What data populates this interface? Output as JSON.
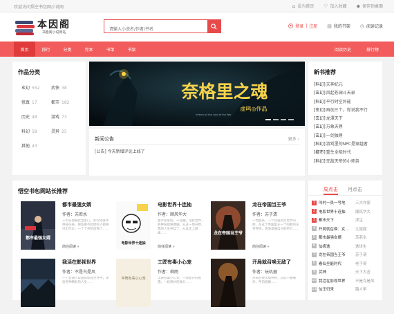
{
  "topbar": {
    "welcome": "欢迎访问悟空书包网小说网",
    "links": [
      "设为首页",
      "加入收藏",
      "保存到桌面"
    ]
  },
  "logo": {
    "title": "本因阁",
    "subtitle": "书趣阁小说网站"
  },
  "search": {
    "placeholder": "请输入小说名/作者/书名"
  },
  "header_links": {
    "login": "登录",
    "sep": "|",
    "register": "注册",
    "bookshelf": "我的书架",
    "history": "阅读记录"
  },
  "nav": {
    "items": [
      "首页",
      "排行",
      "分类",
      "完本",
      "书单",
      "书架"
    ],
    "right": [
      "阅读历史",
      "排行榜"
    ]
  },
  "categories": {
    "title": "作品分类",
    "items": [
      {
        "name": "玄幻",
        "count": "552"
      },
      {
        "name": "武侠",
        "count": "38"
      },
      {
        "name": "修真",
        "count": "17"
      },
      {
        "name": "都市",
        "count": "182"
      },
      {
        "name": "历史",
        "count": "48"
      },
      {
        "name": "游戏",
        "count": "73"
      },
      {
        "name": "科幻",
        "count": "58"
      },
      {
        "name": "灵异",
        "count": "25"
      },
      {
        "name": "其他",
        "count": "43"
      }
    ]
  },
  "banner": {
    "title": "奈格里之魂",
    "caption": "虚鸣◎作品",
    "english": "Inferno of the Lord of the War"
  },
  "news": {
    "title": "新闻公告",
    "more": "更多 ›",
    "item": "[公告] 今天新增评论上线了"
  },
  "recommend": {
    "title": "新书推荐",
    "items": [
      {
        "tag": "[科幻]",
        "name": "天神纪元"
      },
      {
        "tag": "[玄幻]",
        "name": "风起苍澜斗天录"
      },
      {
        "tag": "[科幻]",
        "name": "平行时空异能"
      },
      {
        "tag": "[玄幻]",
        "name": "再创三个，你说我不行"
      },
      {
        "tag": "[玄幻]",
        "name": "龙潭天下"
      },
      {
        "tag": "[玄幻]",
        "name": "万象天尊"
      },
      {
        "tag": "[玄幻]",
        "name": "一剑独尊"
      },
      {
        "tag": "[科幻]",
        "name": "游戏里的NPC是穿越者"
      },
      {
        "tag": "[都市]",
        "name": "重生全能时代"
      },
      {
        "tag": "[科幻]",
        "name": "无敌天帝的小师弟"
      }
    ]
  },
  "site_pick": {
    "title": "悟空书包网站长推荐",
    "books": [
      {
        "title": "都市最强女婿",
        "author": "作者：苏若水",
        "desc": "三年前他被赶出家门，如今他身怀绝技归来，那些看不起他的人都将付出代价，一个个开始后悔了……",
        "go": "前往阅读 »",
        "cover_text": "都市最强女婿"
      },
      {
        "title": "电影世界十连抽",
        "author": "作者：顺风华大",
        "desc": "金手指系统，十连抽，电影世界，各种技能随便抽，从这一刻开始，我的人生开挂了，从此走上巅峰……",
        "go": "前往阅读 »",
        "cover_text": "电影世界十连抽"
      },
      {
        "title": "龙在帝国当王爷",
        "author": "作者：苏子清",
        "desc": "一觉醒来，一个穿越到异世界的他，在这个帝国里从一个闲散的王爷开始，逐渐发展自己的势力……",
        "go": "前往阅读 »",
        "cover_text": "龙在帝国当王爷"
      },
      {
        "title": "我活在影视世界",
        "author": "作者：不是鸟是风",
        "desc": "一个普通人穿越到影视世界中，体验各种精彩的人生……",
        "go": "前往阅读 »",
        "cover_text": ""
      },
      {
        "title": "工匠有毒小心宠",
        "author": "作者：柳雨",
        "desc": "丰碑有毒小心宠，一场意外的相遇，一段奇妙的缘分……",
        "go": "前往阅读 »",
        "cover_text": "丰碑有毒小心宠"
      },
      {
        "title": "开局就召唤无敌了",
        "author": "作者：玩机器",
        "desc": "开局召唤无敌神将，从此一路横扫，所向披靡……",
        "go": "前往阅读 »",
        "cover_text": ""
      }
    ]
  },
  "hot": {
    "tabs": [
      "周点击",
      "月点击"
    ],
    "items": [
      {
        "rank": "1",
        "name": "叫村一员一号地",
        "author": "三大作家"
      },
      {
        "rank": "2",
        "name": "电影世界十连抽",
        "author": "顺风华大"
      },
      {
        "rank": "3",
        "name": "都市天下",
        "author": "浮生"
      },
      {
        "rank": "4",
        "name": "开局就召唤：女...",
        "author": "九尾狐"
      },
      {
        "rank": "5",
        "name": "都市最强女婿",
        "author": "苏若水"
      },
      {
        "rank": "6",
        "name": "仙极逸",
        "author": "逸世生"
      },
      {
        "rank": "7",
        "name": "龙在帝国当王爷",
        "author": "苏子清"
      },
      {
        "rank": "8",
        "name": "看仙全能时代",
        "author": "老子哥"
      },
      {
        "rank": "9",
        "name": "武神",
        "author": "天下大苦"
      },
      {
        "rank": "10",
        "name": "我活在影视世界",
        "author": "不是鸟是风"
      },
      {
        "rank": "11",
        "name": "仙王归来",
        "author": "路人甲"
      }
    ]
  }
}
